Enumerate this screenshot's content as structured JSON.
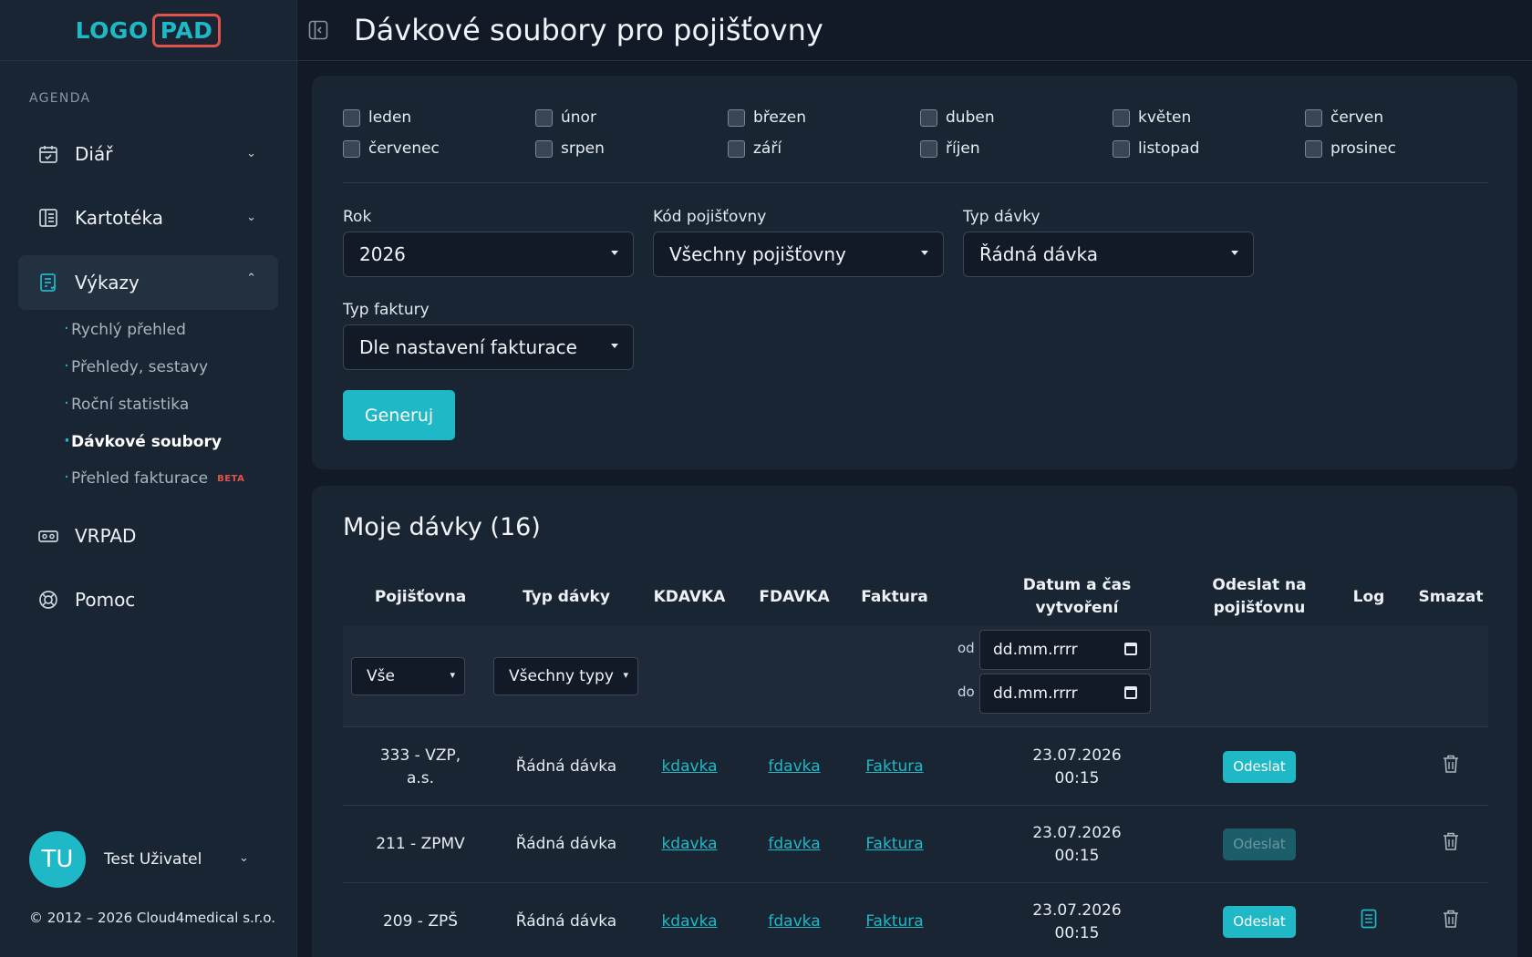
{
  "logo": {
    "part1": "LOGO",
    "part2": "PAD"
  },
  "header": {
    "title": "Dávkové soubory pro pojišťovny"
  },
  "sidebar": {
    "section_label": "AGENDA",
    "items": [
      {
        "label": "Diář"
      },
      {
        "label": "Kartotéka"
      },
      {
        "label": "Výkazy"
      },
      {
        "label": "VRPAD"
      },
      {
        "label": "Pomoc"
      }
    ],
    "sub_items": [
      {
        "label": "Rychlý přehled"
      },
      {
        "label": "Přehledy, sestavy"
      },
      {
        "label": "Roční statistika"
      },
      {
        "label": "Dávkové soubory"
      },
      {
        "label": "Přehled fakturace",
        "badge": "BETA"
      }
    ],
    "user": {
      "initials": "TU",
      "name": "Test Uživatel"
    },
    "copyright": "© 2012 – 2026 Cloud4medical s.r.o."
  },
  "filters": {
    "months": [
      "leden",
      "únor",
      "březen",
      "duben",
      "květen",
      "červen",
      "červenec",
      "srpen",
      "září",
      "říjen",
      "listopad",
      "prosinec"
    ],
    "year_label": "Rok",
    "year_value": "2026",
    "insurer_label": "Kód pojišťovny",
    "insurer_value": "Všechny pojišťovny",
    "batch_type_label": "Typ dávky",
    "batch_type_value": "Řádná dávka",
    "invoice_type_label": "Typ faktury",
    "invoice_type_value": "Dle nastavení fakturace",
    "generate_label": "Generuj"
  },
  "batches": {
    "title": "Moje dávky (16)",
    "columns": {
      "insurer": "Pojišťovna",
      "type": "Typ dávky",
      "kdavka": "KDAVKA",
      "fdavka": "FDAVKA",
      "invoice": "Faktura",
      "created": "Datum a čas vytvoření",
      "send": "Odeslat na pojišťovnu",
      "log": "Log",
      "delete": "Smazat"
    },
    "filter_row": {
      "insurer_value": "Vše",
      "type_value": "Všechny typy",
      "from_label": "od",
      "to_label": "do",
      "date_placeholder": "dd.mm.rrrr"
    },
    "rows": [
      {
        "insurer": "333 - VZP, a.s.",
        "type": "Řádná dávka",
        "kdavka": "kdavka",
        "fdavka": "fdavka",
        "invoice": "Faktura",
        "date": "23.07.2026",
        "time": "00:15",
        "send": "Odeslat"
      },
      {
        "insurer": "211 - ZPMV",
        "type": "Řádná dávka",
        "kdavka": "kdavka",
        "fdavka": "fdavka",
        "invoice": "Faktura",
        "date": "23.07.2026",
        "time": "00:15",
        "send": "Odeslat"
      },
      {
        "insurer": "209 - ZPŠ",
        "type": "Řádná dávka",
        "kdavka": "kdavka",
        "fdavka": "fdavka",
        "invoice": "Faktura",
        "date": "23.07.2026",
        "time": "00:15",
        "send": "Odeslat"
      }
    ]
  },
  "colors": {
    "accent": "#1fb8c6",
    "logo_border": "#e0524a",
    "background": "#111a26",
    "panel": "#1a2533"
  }
}
